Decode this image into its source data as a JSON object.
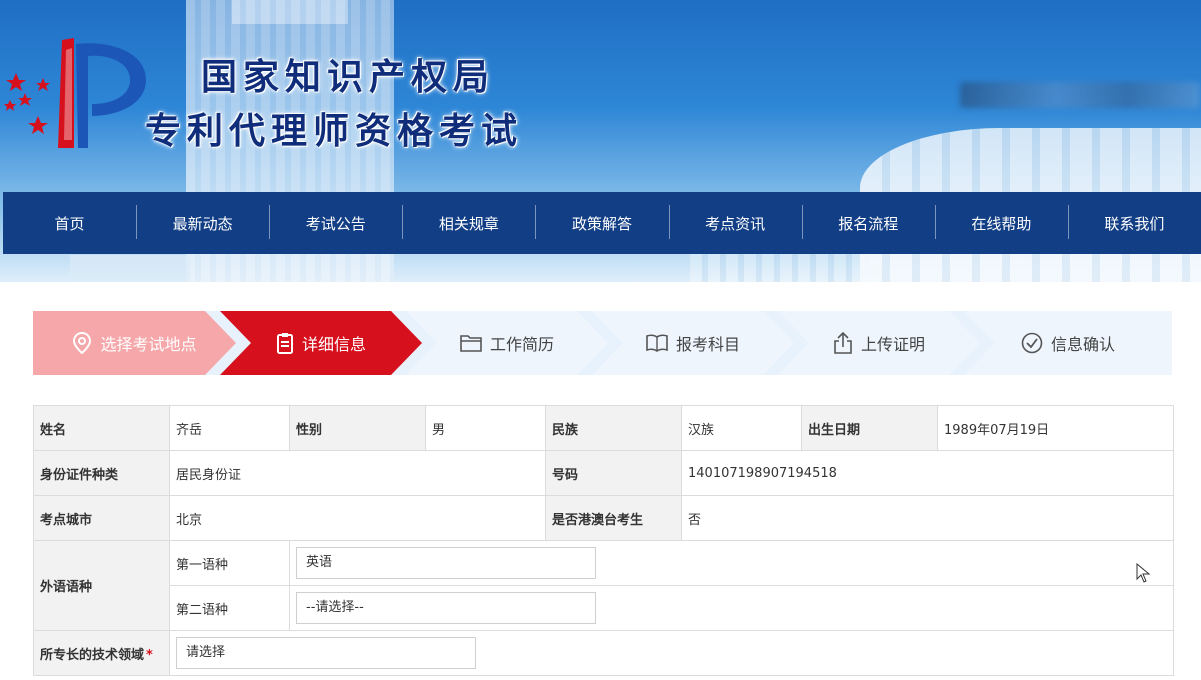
{
  "site": {
    "title_line1": "国家知识产权局",
    "title_line2": "专利代理师资格考试"
  },
  "nav": {
    "items": [
      "首页",
      "最新动态",
      "考试公告",
      "相关规章",
      "政策解答",
      "考点资讯",
      "报名流程",
      "在线帮助",
      "联系我们"
    ]
  },
  "steps": {
    "items": [
      {
        "label": "选择考试地点",
        "icon": "location-pin-icon",
        "state": "done"
      },
      {
        "label": "详细信息",
        "icon": "clipboard-icon",
        "state": "active"
      },
      {
        "label": "工作简历",
        "icon": "folder-icon",
        "state": "pending"
      },
      {
        "label": "报考科目",
        "icon": "book-icon",
        "state": "pending"
      },
      {
        "label": "上传证明",
        "icon": "upload-icon",
        "state": "pending"
      },
      {
        "label": "信息确认",
        "icon": "check-circle-icon",
        "state": "pending"
      }
    ]
  },
  "form": {
    "name_label": "姓名",
    "name_value": "齐岳",
    "gender_label": "性别",
    "gender_value": "男",
    "ethnicity_label": "民族",
    "ethnicity_value": "汉族",
    "birth_label": "出生日期",
    "birth_value": "1989年07月19日",
    "id_type_label": "身份证件种类",
    "id_type_value": "居民身份证",
    "id_number_label": "号码",
    "id_number_value": "140107198907194518",
    "city_label": "考点城市",
    "city_value": "北京",
    "hkmt_label": "是否港澳台考生",
    "hkmt_value": "否",
    "foreign_lang_label": "外语语种",
    "first_lang_label": "第一语种",
    "first_lang_value": "英语",
    "second_lang_label": "第二语种",
    "second_lang_value": "--请选择--",
    "tech_field_label": "所专长的技术领域",
    "tech_field_required_mark": "*",
    "tech_field_value": "请选择"
  },
  "colors": {
    "nav_bg": "#123e85",
    "step_active": "#d7101d",
    "step_done": "#f6a7aa",
    "step_pending": "#eef5fd",
    "title_text": "#0f2d7a"
  }
}
